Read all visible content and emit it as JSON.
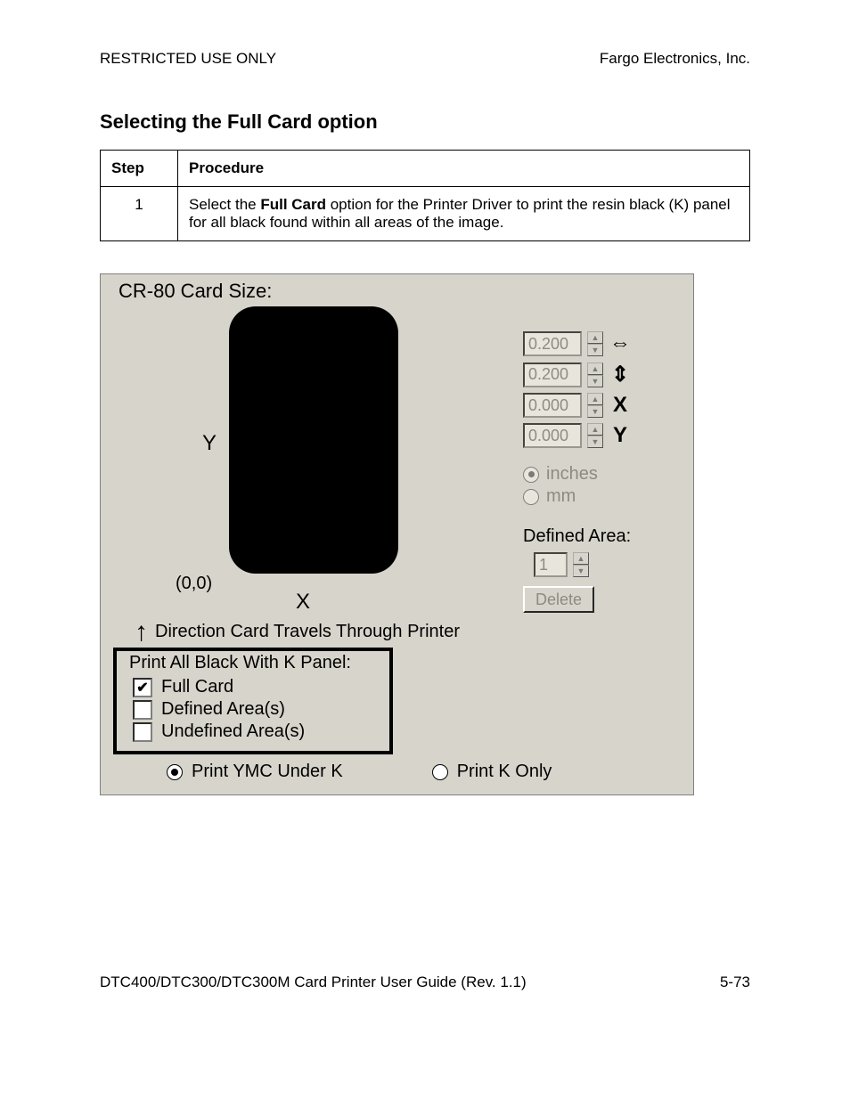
{
  "header": {
    "left": "RESTRICTED USE ONLY",
    "right": "Fargo Electronics, Inc."
  },
  "section_title": "Selecting the Full Card option",
  "table": {
    "headers": {
      "step": "Step",
      "procedure": "Procedure"
    },
    "rows": [
      {
        "num": "1",
        "text_pre": "Select the ",
        "text_bold": "Full Card",
        "text_post": " option for the Printer Driver to print the resin black (K) panel for all black found within all areas of the image."
      }
    ]
  },
  "dialog": {
    "title": "CR-80 Card Size:",
    "axis_y": "Y",
    "origin": "(0,0)",
    "axis_x": "X",
    "direction_text": "Direction Card Travels Through Printer",
    "spins": {
      "width": "0.200",
      "height": "0.200",
      "x": "0.000",
      "y": "0.000"
    },
    "icons": {
      "width": "↔",
      "height": "↕",
      "x": "X",
      "y": "Y"
    },
    "units": {
      "inches": "inches",
      "mm": "mm",
      "selected": "inches"
    },
    "defined_area_label": "Defined Area:",
    "defined_area_value": "1",
    "delete_label": "Delete",
    "group_title": "Print All Black With K Panel:",
    "checks": {
      "full_card": {
        "label": "Full Card",
        "checked": true
      },
      "defined": {
        "label": "Defined Area(s)",
        "checked": false
      },
      "undefined": {
        "label": "Undefined Area(s)",
        "checked": false
      }
    },
    "bottom_radios": {
      "ymc": "Print YMC Under K",
      "konly": "Print K Only",
      "selected": "ymc"
    }
  },
  "footer": {
    "left": "DTC400/DTC300/DTC300M Card Printer User Guide (Rev. 1.1)",
    "right": "5-73"
  }
}
